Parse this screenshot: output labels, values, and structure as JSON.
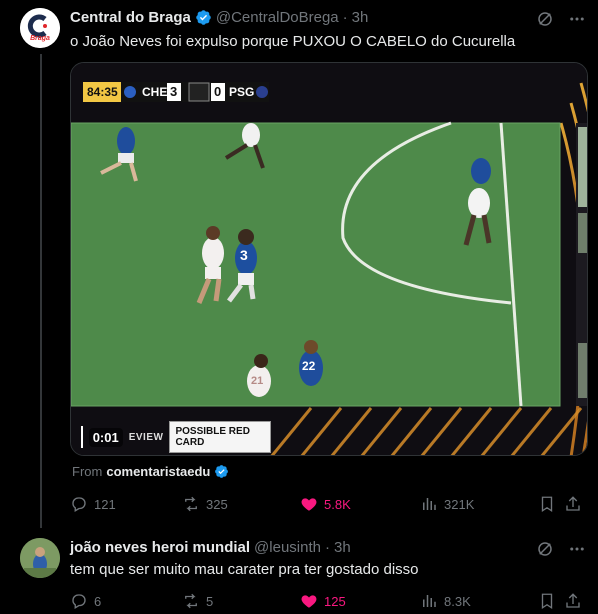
{
  "tweet1": {
    "author_name": "Central do Braga",
    "handle": "@CentralDoBrega",
    "separator": "·",
    "time": "3h",
    "avatar_logo_text": "Braga",
    "text": "o João Neves foi expulso porque PUXOU O CABELO do Cucurella",
    "media": {
      "scorebug": {
        "clock": "84:35",
        "home_team": "CHE",
        "home_score": "3",
        "away_team": "PSG",
        "away_score": "0"
      },
      "video_time": "0:01",
      "review_label": "EVIEW",
      "banner_text": "POSSIBLE RED CARD",
      "player_numbers": [
        "3",
        "22",
        "21"
      ]
    },
    "from_label": "From",
    "from_source": "comentaristaedu",
    "actions": {
      "replies": "121",
      "reposts": "325",
      "likes": "5.8K",
      "views": "321K"
    }
  },
  "tweet2": {
    "author_name": "joão neves heroi mundial",
    "handle": "@leusinth",
    "separator": "·",
    "time": "3h",
    "text": "tem que ser muito mau carater pra ter gostado disso",
    "actions": {
      "replies": "6",
      "reposts": "5",
      "likes": "125",
      "views": "8.3K"
    }
  },
  "colors": {
    "background": "#000000",
    "text_primary": "#e7e9ea",
    "text_secondary": "#71767b",
    "like_pink": "#f91880",
    "verified_blue": "#1d9bf0",
    "pitch_green": "#4e8a4a"
  },
  "icons": [
    "verified-badge-icon",
    "grok-icon",
    "more-icon",
    "reply-icon",
    "repost-icon",
    "like-icon",
    "views-icon",
    "bookmark-icon",
    "share-icon"
  ]
}
